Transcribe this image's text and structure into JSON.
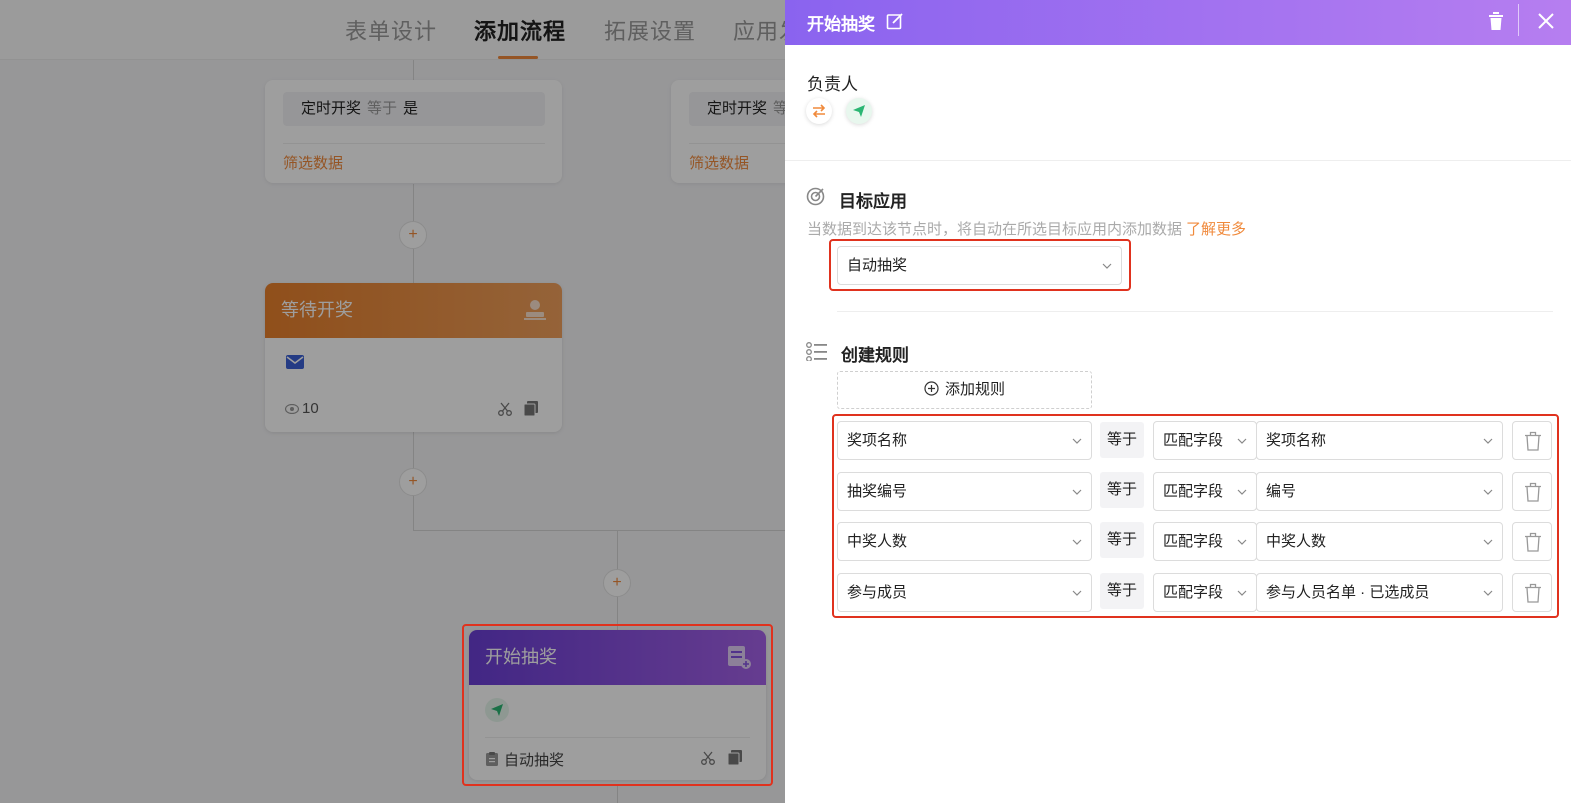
{
  "nav": {
    "tabs": [
      "表单设计",
      "添加流程",
      "拓展设置",
      "应用发"
    ]
  },
  "canvas": {
    "cond_left": {
      "field": "定时开奖",
      "op": "等于",
      "value": "是",
      "filter": "筛选数据"
    },
    "cond_right": {
      "field": "定时开奖",
      "op": "等",
      "filter": "筛选数据"
    },
    "plus": "+",
    "wait_node": {
      "title": "等待开奖",
      "views": "10"
    },
    "start_node": {
      "title": "开始抽奖",
      "target": "自动抽奖"
    }
  },
  "panel": {
    "title": "开始抽奖",
    "owner_title": "负责人",
    "target_title": "目标应用",
    "target_desc": "当数据到达该节点时，将自动在所选目标应用内添加数据",
    "learn_more": "了解更多",
    "target_app": "自动抽奖",
    "rules_title": "创建规则",
    "add_rule": "添加规则",
    "rules": [
      {
        "field": "奖项名称",
        "op": "等于",
        "mode": "匹配字段",
        "value": "奖项名称"
      },
      {
        "field": "抽奖编号",
        "op": "等于",
        "mode": "匹配字段",
        "value": "编号"
      },
      {
        "field": "中奖人数",
        "op": "等于",
        "mode": "匹配字段",
        "value": "中奖人数"
      },
      {
        "field": "参与成员",
        "op": "等于",
        "mode": "匹配字段",
        "value": "参与人员名单 · 已选成员"
      }
    ]
  },
  "colors": {
    "accent": "#f08a3c",
    "purple": "#8a63ef",
    "highlight": "#e0321e"
  }
}
